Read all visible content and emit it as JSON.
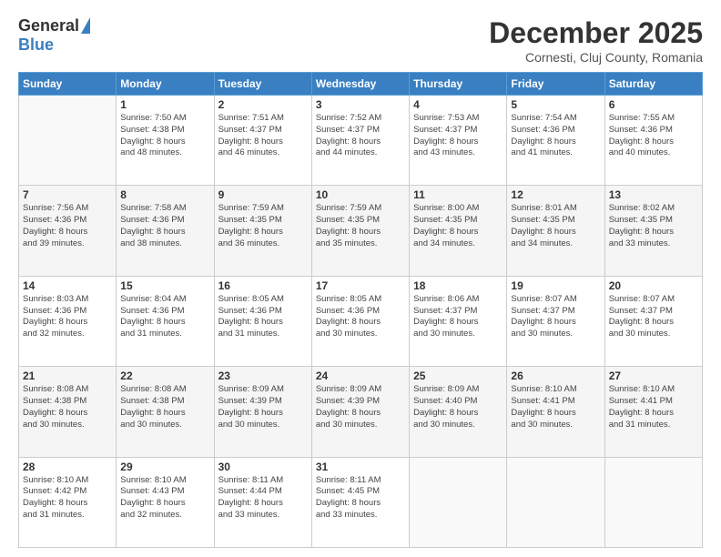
{
  "logo": {
    "general": "General",
    "blue": "Blue"
  },
  "header": {
    "month": "December 2025",
    "location": "Cornesti, Cluj County, Romania"
  },
  "weekdays": [
    "Sunday",
    "Monday",
    "Tuesday",
    "Wednesday",
    "Thursday",
    "Friday",
    "Saturday"
  ],
  "weeks": [
    [
      {
        "day": "",
        "info": ""
      },
      {
        "day": "1",
        "info": "Sunrise: 7:50 AM\nSunset: 4:38 PM\nDaylight: 8 hours\nand 48 minutes."
      },
      {
        "day": "2",
        "info": "Sunrise: 7:51 AM\nSunset: 4:37 PM\nDaylight: 8 hours\nand 46 minutes."
      },
      {
        "day": "3",
        "info": "Sunrise: 7:52 AM\nSunset: 4:37 PM\nDaylight: 8 hours\nand 44 minutes."
      },
      {
        "day": "4",
        "info": "Sunrise: 7:53 AM\nSunset: 4:37 PM\nDaylight: 8 hours\nand 43 minutes."
      },
      {
        "day": "5",
        "info": "Sunrise: 7:54 AM\nSunset: 4:36 PM\nDaylight: 8 hours\nand 41 minutes."
      },
      {
        "day": "6",
        "info": "Sunrise: 7:55 AM\nSunset: 4:36 PM\nDaylight: 8 hours\nand 40 minutes."
      }
    ],
    [
      {
        "day": "7",
        "info": "Sunrise: 7:56 AM\nSunset: 4:36 PM\nDaylight: 8 hours\nand 39 minutes."
      },
      {
        "day": "8",
        "info": "Sunrise: 7:58 AM\nSunset: 4:36 PM\nDaylight: 8 hours\nand 38 minutes."
      },
      {
        "day": "9",
        "info": "Sunrise: 7:59 AM\nSunset: 4:35 PM\nDaylight: 8 hours\nand 36 minutes."
      },
      {
        "day": "10",
        "info": "Sunrise: 7:59 AM\nSunset: 4:35 PM\nDaylight: 8 hours\nand 35 minutes."
      },
      {
        "day": "11",
        "info": "Sunrise: 8:00 AM\nSunset: 4:35 PM\nDaylight: 8 hours\nand 34 minutes."
      },
      {
        "day": "12",
        "info": "Sunrise: 8:01 AM\nSunset: 4:35 PM\nDaylight: 8 hours\nand 34 minutes."
      },
      {
        "day": "13",
        "info": "Sunrise: 8:02 AM\nSunset: 4:35 PM\nDaylight: 8 hours\nand 33 minutes."
      }
    ],
    [
      {
        "day": "14",
        "info": "Sunrise: 8:03 AM\nSunset: 4:36 PM\nDaylight: 8 hours\nand 32 minutes."
      },
      {
        "day": "15",
        "info": "Sunrise: 8:04 AM\nSunset: 4:36 PM\nDaylight: 8 hours\nand 31 minutes."
      },
      {
        "day": "16",
        "info": "Sunrise: 8:05 AM\nSunset: 4:36 PM\nDaylight: 8 hours\nand 31 minutes."
      },
      {
        "day": "17",
        "info": "Sunrise: 8:05 AM\nSunset: 4:36 PM\nDaylight: 8 hours\nand 30 minutes."
      },
      {
        "day": "18",
        "info": "Sunrise: 8:06 AM\nSunset: 4:37 PM\nDaylight: 8 hours\nand 30 minutes."
      },
      {
        "day": "19",
        "info": "Sunrise: 8:07 AM\nSunset: 4:37 PM\nDaylight: 8 hours\nand 30 minutes."
      },
      {
        "day": "20",
        "info": "Sunrise: 8:07 AM\nSunset: 4:37 PM\nDaylight: 8 hours\nand 30 minutes."
      }
    ],
    [
      {
        "day": "21",
        "info": "Sunrise: 8:08 AM\nSunset: 4:38 PM\nDaylight: 8 hours\nand 30 minutes."
      },
      {
        "day": "22",
        "info": "Sunrise: 8:08 AM\nSunset: 4:38 PM\nDaylight: 8 hours\nand 30 minutes."
      },
      {
        "day": "23",
        "info": "Sunrise: 8:09 AM\nSunset: 4:39 PM\nDaylight: 8 hours\nand 30 minutes."
      },
      {
        "day": "24",
        "info": "Sunrise: 8:09 AM\nSunset: 4:39 PM\nDaylight: 8 hours\nand 30 minutes."
      },
      {
        "day": "25",
        "info": "Sunrise: 8:09 AM\nSunset: 4:40 PM\nDaylight: 8 hours\nand 30 minutes."
      },
      {
        "day": "26",
        "info": "Sunrise: 8:10 AM\nSunset: 4:41 PM\nDaylight: 8 hours\nand 30 minutes."
      },
      {
        "day": "27",
        "info": "Sunrise: 8:10 AM\nSunset: 4:41 PM\nDaylight: 8 hours\nand 31 minutes."
      }
    ],
    [
      {
        "day": "28",
        "info": "Sunrise: 8:10 AM\nSunset: 4:42 PM\nDaylight: 8 hours\nand 31 minutes."
      },
      {
        "day": "29",
        "info": "Sunrise: 8:10 AM\nSunset: 4:43 PM\nDaylight: 8 hours\nand 32 minutes."
      },
      {
        "day": "30",
        "info": "Sunrise: 8:11 AM\nSunset: 4:44 PM\nDaylight: 8 hours\nand 33 minutes."
      },
      {
        "day": "31",
        "info": "Sunrise: 8:11 AM\nSunset: 4:45 PM\nDaylight: 8 hours\nand 33 minutes."
      },
      {
        "day": "",
        "info": ""
      },
      {
        "day": "",
        "info": ""
      },
      {
        "day": "",
        "info": ""
      }
    ]
  ]
}
